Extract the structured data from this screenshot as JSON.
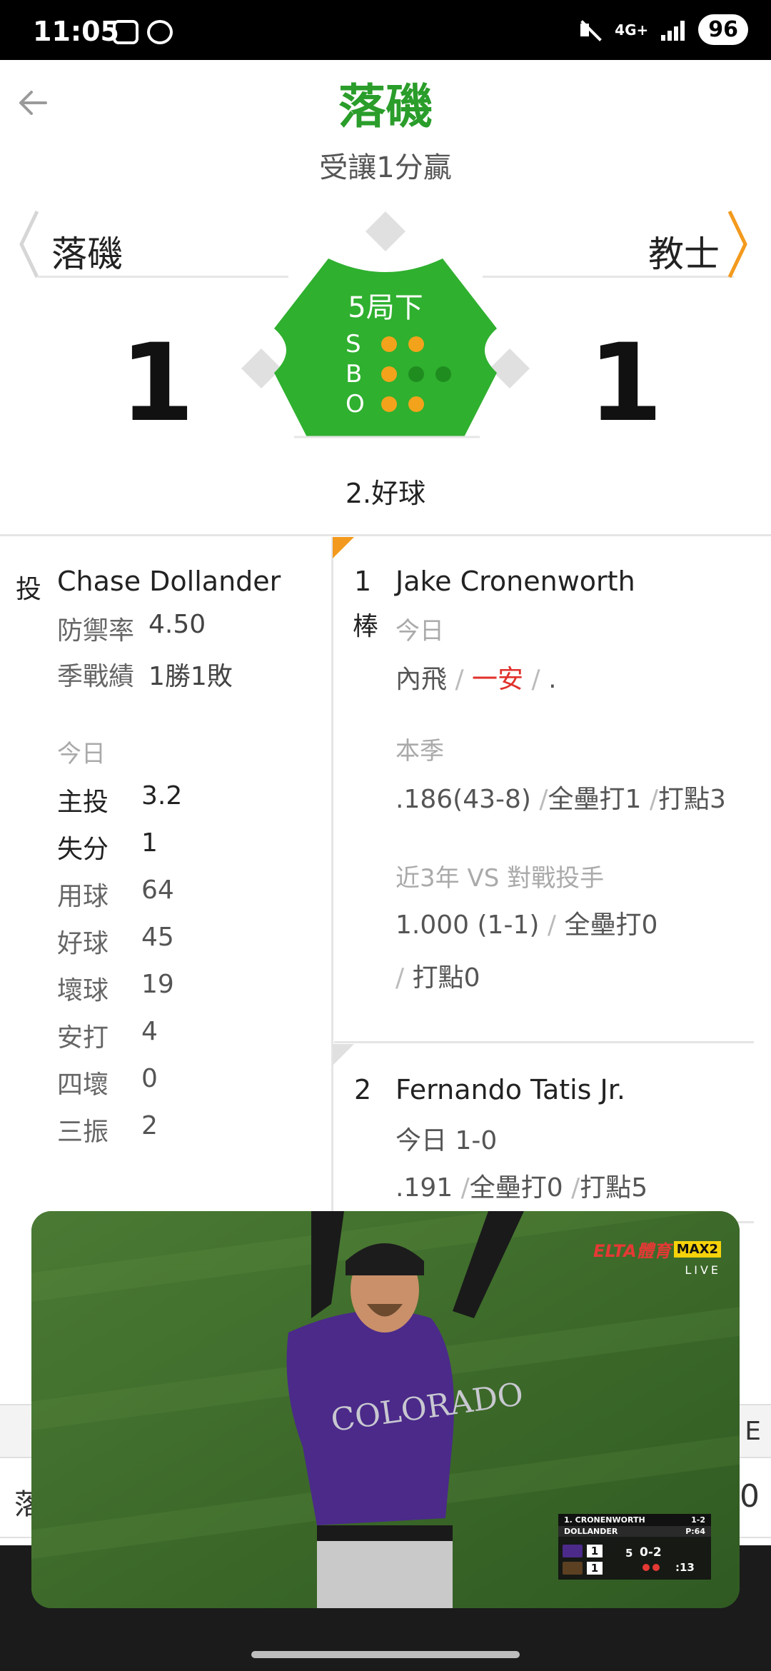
{
  "status_bar": {
    "time": "11:05",
    "network": "4G+",
    "battery": "96"
  },
  "header": {
    "title": "落磯",
    "subtitle": "受讓1分贏"
  },
  "scoreboard": {
    "away_team": "落磯",
    "home_team": "教士",
    "away_score": "1",
    "home_score": "1",
    "inning": "5局下",
    "count_labels": {
      "strikes": "S",
      "balls": "B",
      "outs": "O"
    },
    "strikes": 2,
    "balls": 1,
    "outs": 2,
    "last_pitch": "2.好球",
    "colors": {
      "field": "#2fb02f",
      "brand": "#2a9d2a",
      "accent": "#f3a21b"
    }
  },
  "pitcher": {
    "tag": "投",
    "name": "Chase Dollander",
    "era_label": "防禦率",
    "era": "4.50",
    "record_label": "季戰績",
    "record": "1勝1敗",
    "today_label": "今日",
    "stats": [
      {
        "label": "主投",
        "value": "3.2"
      },
      {
        "label": "失分",
        "value": "1"
      },
      {
        "label": "用球",
        "value": "64"
      },
      {
        "label": "好球",
        "value": "45"
      },
      {
        "label": "壞球",
        "value": "19"
      },
      {
        "label": "安打",
        "value": "4"
      },
      {
        "label": "四壞",
        "value": "0"
      },
      {
        "label": "三振",
        "value": "2"
      }
    ]
  },
  "batters": [
    {
      "order": "1",
      "tag": "棒",
      "name": "Jake Cronenworth",
      "today_label": "今日",
      "today_results": [
        "內飛",
        "一安",
        "."
      ],
      "season_label": "本季",
      "season_avg": ".186(43-8)",
      "season_hr": "全壘打1",
      "season_rbi": "打點3",
      "vs_label": "近3年 VS 對戰投手",
      "vs_avg": "1.000 (1-1)",
      "vs_hr": "全壘打0",
      "vs_rbi": "打點0"
    },
    {
      "order": "2",
      "name": "Fernando Tatis Jr.",
      "today": "今日 1-0",
      "season_avg": ".191",
      "season_hr": "全壘打0",
      "season_rbi": "打點5"
    }
  ],
  "background_table": {
    "header_e": "E",
    "team": "落",
    "value": "0"
  },
  "video": {
    "logo_text": "ELTA體育",
    "channel": "MAX2",
    "live": "LIVE",
    "bug": {
      "batter": "1. CRONENWORTH",
      "batter_count": "1-2",
      "pitcher": "DOLLANDER",
      "pitch_count": "P:64",
      "away_score": "1",
      "home_score": "1",
      "inning": "5",
      "count": "0-2",
      "clock": ":13"
    }
  }
}
